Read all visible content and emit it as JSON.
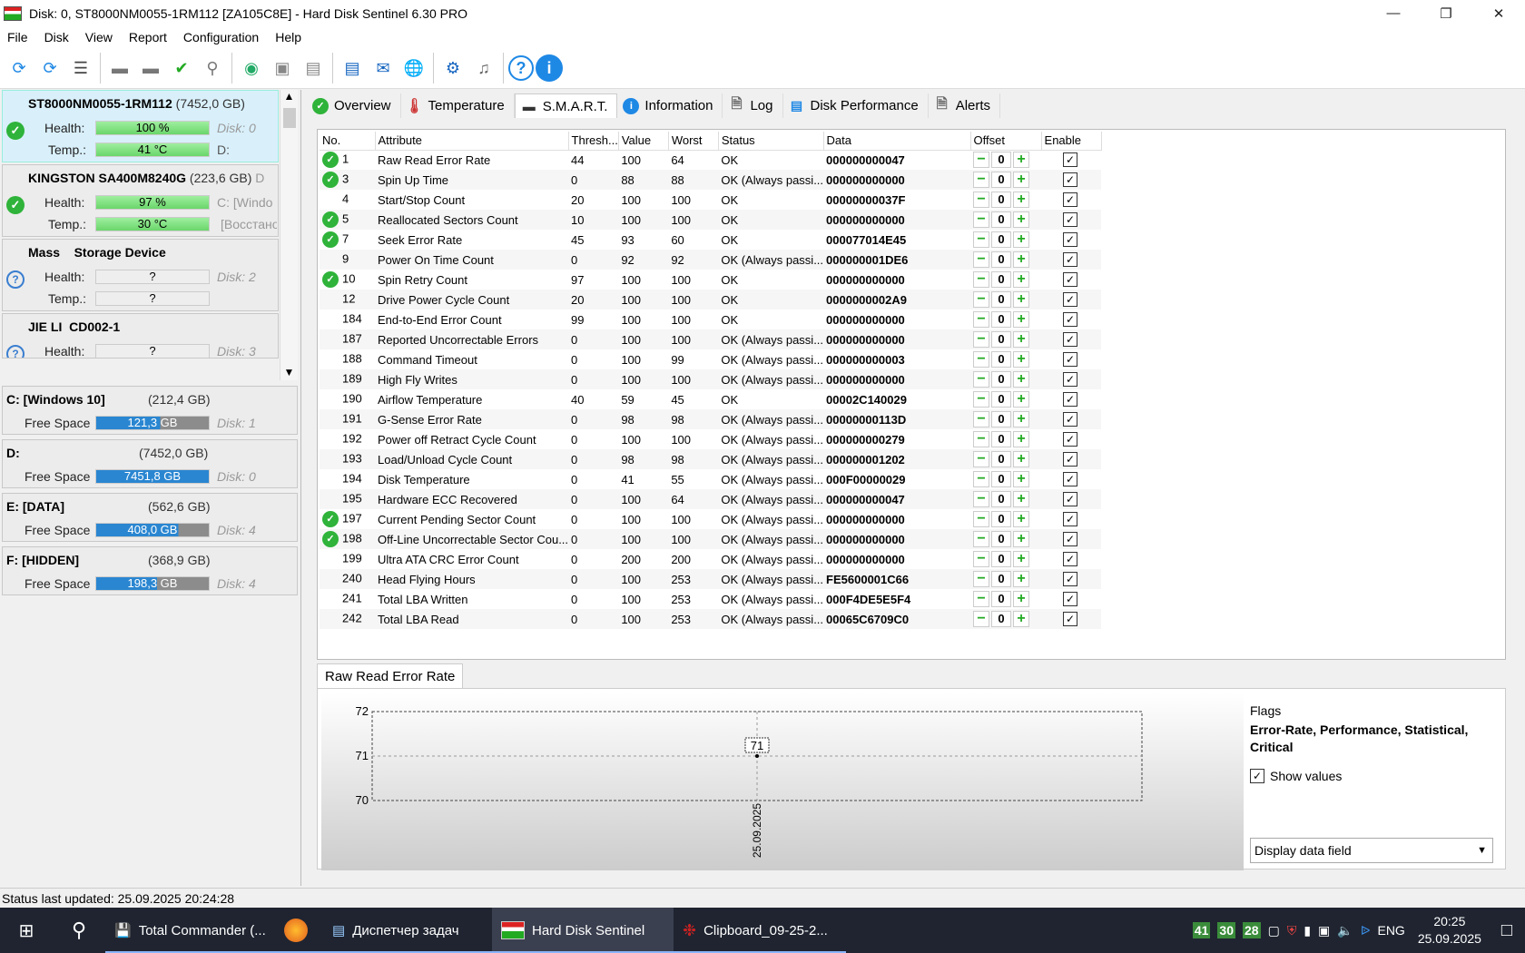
{
  "window": {
    "title": "Disk: 0, ST8000NM0055-1RM112 [ZA105C8E]  -  Hard Disk Sentinel 6.30 PRO"
  },
  "menu": [
    "File",
    "Disk",
    "View",
    "Report",
    "Configuration",
    "Help"
  ],
  "toolbar_icons": [
    "refresh-icon",
    "refresh-warning-icon",
    "disk-list-icon",
    "disk-icon",
    "disk-schedule-icon",
    "disk-check-icon",
    "disk-search-icon",
    "network-disk-icon",
    "usb-disk-icon",
    "external-disk-icon",
    "report-icon",
    "mail-icon",
    "globe-icon",
    "settings-icon",
    "sound-icon",
    "help-icon",
    "info-icon"
  ],
  "disks": [
    {
      "name": "ST8000NM0055-1RM112",
      "size": "(7452,0 GB)",
      "health_label": "Health:",
      "health": "100 %",
      "health_fill": 1.0,
      "temp_label": "Temp.:",
      "temp": "41 °C",
      "right1": "Disk: 0",
      "right2": "D:"
    },
    {
      "name": "KINGSTON SA400M8240G",
      "size": "(223,6 GB)",
      "extra": "D",
      "health_label": "Health:",
      "health": "97 %",
      "health_fill": 0.97,
      "temp_label": "Temp.:",
      "temp": "30 °C",
      "right1": "C: [Windo",
      "right2": "[Восстано"
    },
    {
      "name": "Mass    Storage Device",
      "size": "",
      "health_label": "Health:",
      "health": "?",
      "temp_label": "Temp.:",
      "temp": "?",
      "right1": "Disk: 2",
      "right2": ""
    },
    {
      "name": "JIE LI  CD002-1",
      "size": "",
      "health_label": "Health:",
      "health": "?",
      "right1": "Disk: 3"
    }
  ],
  "volumes": [
    {
      "name": "C: [Windows 10]",
      "size": "(212,4 GB)",
      "free_label": "Free Space",
      "free": "121,3 GB",
      "free_fill": 0.57,
      "disk": "Disk: 1"
    },
    {
      "name": "D:",
      "size": "(7452,0 GB)",
      "free_label": "Free Space",
      "free": "7451,8 GB",
      "free_fill": 1.0,
      "disk": "Disk: 0"
    },
    {
      "name": "E: [DATA]",
      "size": "(562,6 GB)",
      "free_label": "Free Space",
      "free": "408,0 GB",
      "free_fill": 0.73,
      "disk": "Disk: 4"
    },
    {
      "name": "F: [HIDDEN]",
      "size": "(368,9 GB)",
      "free_label": "Free Space",
      "free": "198,3 GB",
      "free_fill": 0.54,
      "disk": "Disk: 4"
    }
  ],
  "tabs": [
    "Overview",
    "Temperature",
    "S.M.A.R.T.",
    "Information",
    "Log",
    "Disk Performance",
    "Alerts"
  ],
  "table": {
    "headers": [
      "No.",
      "Attribute",
      "Thresh...",
      "Value",
      "Worst",
      "Status",
      "Data",
      "Offset",
      "Enable"
    ],
    "rows": [
      {
        "ok": true,
        "no": "1",
        "attr": "Raw Read Error Rate",
        "thr": "44",
        "val": "100",
        "worst": "64",
        "status": "OK",
        "data": "000000000047",
        "offset": "0"
      },
      {
        "ok": true,
        "no": "3",
        "attr": "Spin Up Time",
        "thr": "0",
        "val": "88",
        "worst": "88",
        "status": "OK (Always passi...",
        "data": "000000000000",
        "offset": "0"
      },
      {
        "ok": false,
        "no": "4",
        "attr": "Start/Stop Count",
        "thr": "20",
        "val": "100",
        "worst": "100",
        "status": "OK",
        "data": "00000000037F",
        "offset": "0"
      },
      {
        "ok": true,
        "no": "5",
        "attr": "Reallocated Sectors Count",
        "thr": "10",
        "val": "100",
        "worst": "100",
        "status": "OK",
        "data": "000000000000",
        "offset": "0"
      },
      {
        "ok": true,
        "no": "7",
        "attr": "Seek Error Rate",
        "thr": "45",
        "val": "93",
        "worst": "60",
        "status": "OK",
        "data": "000077014E45",
        "offset": "0"
      },
      {
        "ok": false,
        "no": "9",
        "attr": "Power On Time Count",
        "thr": "0",
        "val": "92",
        "worst": "92",
        "status": "OK (Always passi...",
        "data": "000000001DE6",
        "offset": "0"
      },
      {
        "ok": true,
        "no": "10",
        "attr": "Spin Retry Count",
        "thr": "97",
        "val": "100",
        "worst": "100",
        "status": "OK",
        "data": "000000000000",
        "offset": "0"
      },
      {
        "ok": false,
        "no": "12",
        "attr": "Drive Power Cycle Count",
        "thr": "20",
        "val": "100",
        "worst": "100",
        "status": "OK",
        "data": "0000000002A9",
        "offset": "0"
      },
      {
        "ok": false,
        "no": "184",
        "attr": "End-to-End Error Count",
        "thr": "99",
        "val": "100",
        "worst": "100",
        "status": "OK",
        "data": "000000000000",
        "offset": "0"
      },
      {
        "ok": false,
        "no": "187",
        "attr": "Reported Uncorrectable Errors",
        "thr": "0",
        "val": "100",
        "worst": "100",
        "status": "OK (Always passi...",
        "data": "000000000000",
        "offset": "0"
      },
      {
        "ok": false,
        "no": "188",
        "attr": "Command Timeout",
        "thr": "0",
        "val": "100",
        "worst": "99",
        "status": "OK (Always passi...",
        "data": "000000000003",
        "offset": "0"
      },
      {
        "ok": false,
        "no": "189",
        "attr": "High Fly Writes",
        "thr": "0",
        "val": "100",
        "worst": "100",
        "status": "OK (Always passi...",
        "data": "000000000000",
        "offset": "0"
      },
      {
        "ok": false,
        "no": "190",
        "attr": "Airflow Temperature",
        "thr": "40",
        "val": "59",
        "worst": "45",
        "status": "OK",
        "data": "00002C140029",
        "offset": "0"
      },
      {
        "ok": false,
        "no": "191",
        "attr": "G-Sense Error Rate",
        "thr": "0",
        "val": "98",
        "worst": "98",
        "status": "OK (Always passi...",
        "data": "00000000113D",
        "offset": "0"
      },
      {
        "ok": false,
        "no": "192",
        "attr": "Power off Retract Cycle Count",
        "thr": "0",
        "val": "100",
        "worst": "100",
        "status": "OK (Always passi...",
        "data": "000000000279",
        "offset": "0"
      },
      {
        "ok": false,
        "no": "193",
        "attr": "Load/Unload Cycle Count",
        "thr": "0",
        "val": "98",
        "worst": "98",
        "status": "OK (Always passi...",
        "data": "000000001202",
        "offset": "0"
      },
      {
        "ok": false,
        "no": "194",
        "attr": "Disk Temperature",
        "thr": "0",
        "val": "41",
        "worst": "55",
        "status": "OK (Always passi...",
        "data": "000F00000029",
        "offset": "0"
      },
      {
        "ok": false,
        "no": "195",
        "attr": "Hardware ECC Recovered",
        "thr": "0",
        "val": "100",
        "worst": "64",
        "status": "OK (Always passi...",
        "data": "000000000047",
        "offset": "0"
      },
      {
        "ok": true,
        "no": "197",
        "attr": "Current Pending Sector Count",
        "thr": "0",
        "val": "100",
        "worst": "100",
        "status": "OK (Always passi...",
        "data": "000000000000",
        "offset": "0"
      },
      {
        "ok": true,
        "no": "198",
        "attr": "Off-Line Uncorrectable Sector Cou...",
        "thr": "0",
        "val": "100",
        "worst": "100",
        "status": "OK (Always passi...",
        "data": "000000000000",
        "offset": "0"
      },
      {
        "ok": false,
        "no": "199",
        "attr": "Ultra ATA CRC Error Count",
        "thr": "0",
        "val": "200",
        "worst": "200",
        "status": "OK (Always passi...",
        "data": "000000000000",
        "offset": "0"
      },
      {
        "ok": false,
        "no": "240",
        "attr": "Head Flying Hours",
        "thr": "0",
        "val": "100",
        "worst": "253",
        "status": "OK (Always passi...",
        "data": "FE5600001C66",
        "offset": "0"
      },
      {
        "ok": false,
        "no": "241",
        "attr": "Total LBA Written",
        "thr": "0",
        "val": "100",
        "worst": "253",
        "status": "OK (Always passi...",
        "data": "000F4DE5E5F4",
        "offset": "0"
      },
      {
        "ok": false,
        "no": "242",
        "attr": "Total LBA Read",
        "thr": "0",
        "val": "100",
        "worst": "253",
        "status": "OK (Always passi...",
        "data": "00065C6709C0",
        "offset": "0"
      }
    ]
  },
  "graph": {
    "tab_label": "Raw Read Error Rate",
    "flags_title": "Flags",
    "flags_value": "Error-Rate, Performance, Statistical, Critical",
    "show_values_label": "Show values",
    "dropdown_value": "Display data field"
  },
  "chart_data": {
    "type": "line",
    "x": [
      "25.09.2025"
    ],
    "y": [
      71
    ],
    "ylim": [
      70,
      72
    ],
    "yticks": [
      "72",
      "71",
      "70"
    ],
    "data_labels": [
      "71"
    ],
    "grid": true
  },
  "status": "Status last updated: 25.09.2025 20:24:28",
  "taskbar": {
    "items": [
      "Total Commander (...",
      "",
      "Диспетчер задач",
      "Hard Disk Sentinel",
      "Clipboard_09-25-2..."
    ],
    "tray_temps": [
      "41",
      "30",
      "28"
    ],
    "lang": "ENG",
    "time": "20:25",
    "date": "25.09.2025"
  }
}
